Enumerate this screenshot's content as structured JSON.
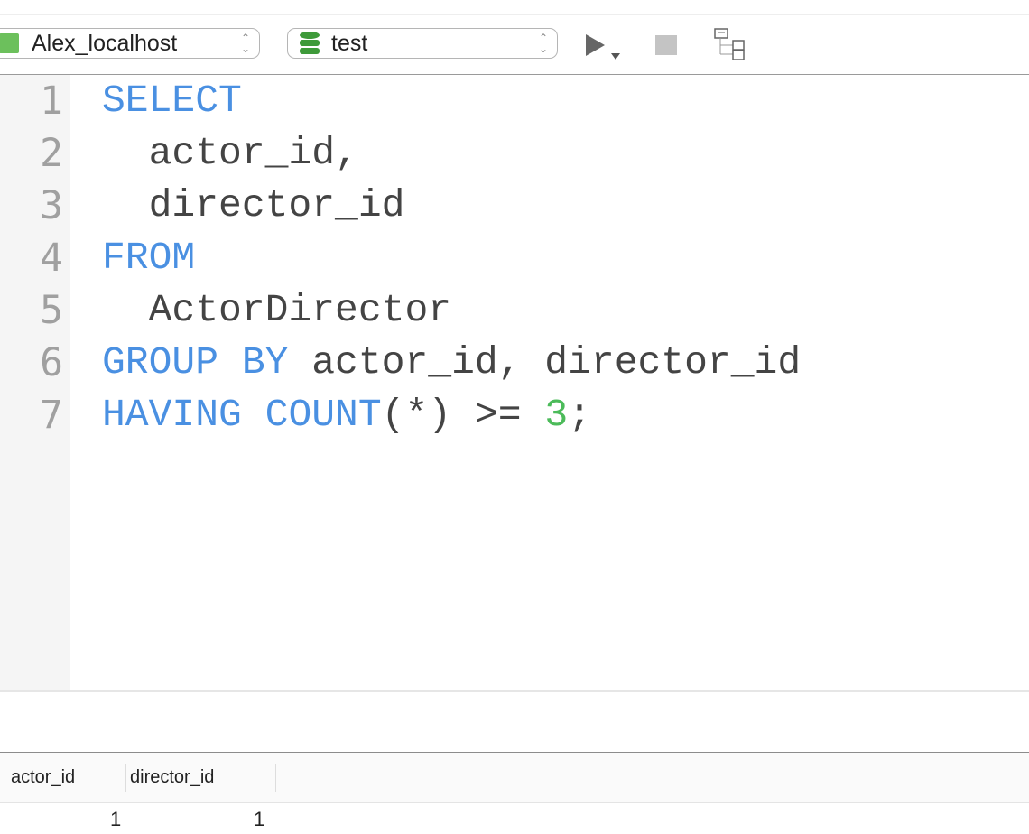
{
  "toolbar": {
    "connection": {
      "label": "Alex_localhost",
      "icon": "mysql-dolphin-icon",
      "color": "#6cc05c"
    },
    "database": {
      "label": "test",
      "icon": "database-icon",
      "color": "#3e9a3a"
    },
    "run_icon": "play-icon",
    "stop_icon": "stop-icon",
    "explain_icon": "tree-icon"
  },
  "editor": {
    "lines": [
      {
        "number": "1",
        "tokens": [
          {
            "t": "SELECT",
            "k": "kw"
          }
        ]
      },
      {
        "number": "2",
        "tokens": [
          {
            "t": "  actor_id,",
            "k": ""
          }
        ]
      },
      {
        "number": "3",
        "tokens": [
          {
            "t": "  director_id",
            "k": ""
          }
        ]
      },
      {
        "number": "4",
        "tokens": [
          {
            "t": "FROM",
            "k": "kw"
          }
        ]
      },
      {
        "number": "5",
        "tokens": [
          {
            "t": "  ActorDirector",
            "k": ""
          }
        ]
      },
      {
        "number": "6",
        "tokens": [
          {
            "t": "GROUP BY",
            "k": "kw"
          },
          {
            "t": " actor_id, director_id",
            "k": ""
          }
        ]
      },
      {
        "number": "7",
        "tokens": [
          {
            "t": "HAVING",
            "k": "kw"
          },
          {
            "t": " ",
            "k": ""
          },
          {
            "t": "COUNT",
            "k": "kw"
          },
          {
            "t": "(*) >= ",
            "k": ""
          },
          {
            "t": "3",
            "k": "num"
          },
          {
            "t": ";",
            "k": ""
          }
        ]
      }
    ]
  },
  "results": {
    "columns": [
      "actor_id",
      "director_id"
    ],
    "rows": [
      [
        "1",
        "1"
      ]
    ]
  }
}
